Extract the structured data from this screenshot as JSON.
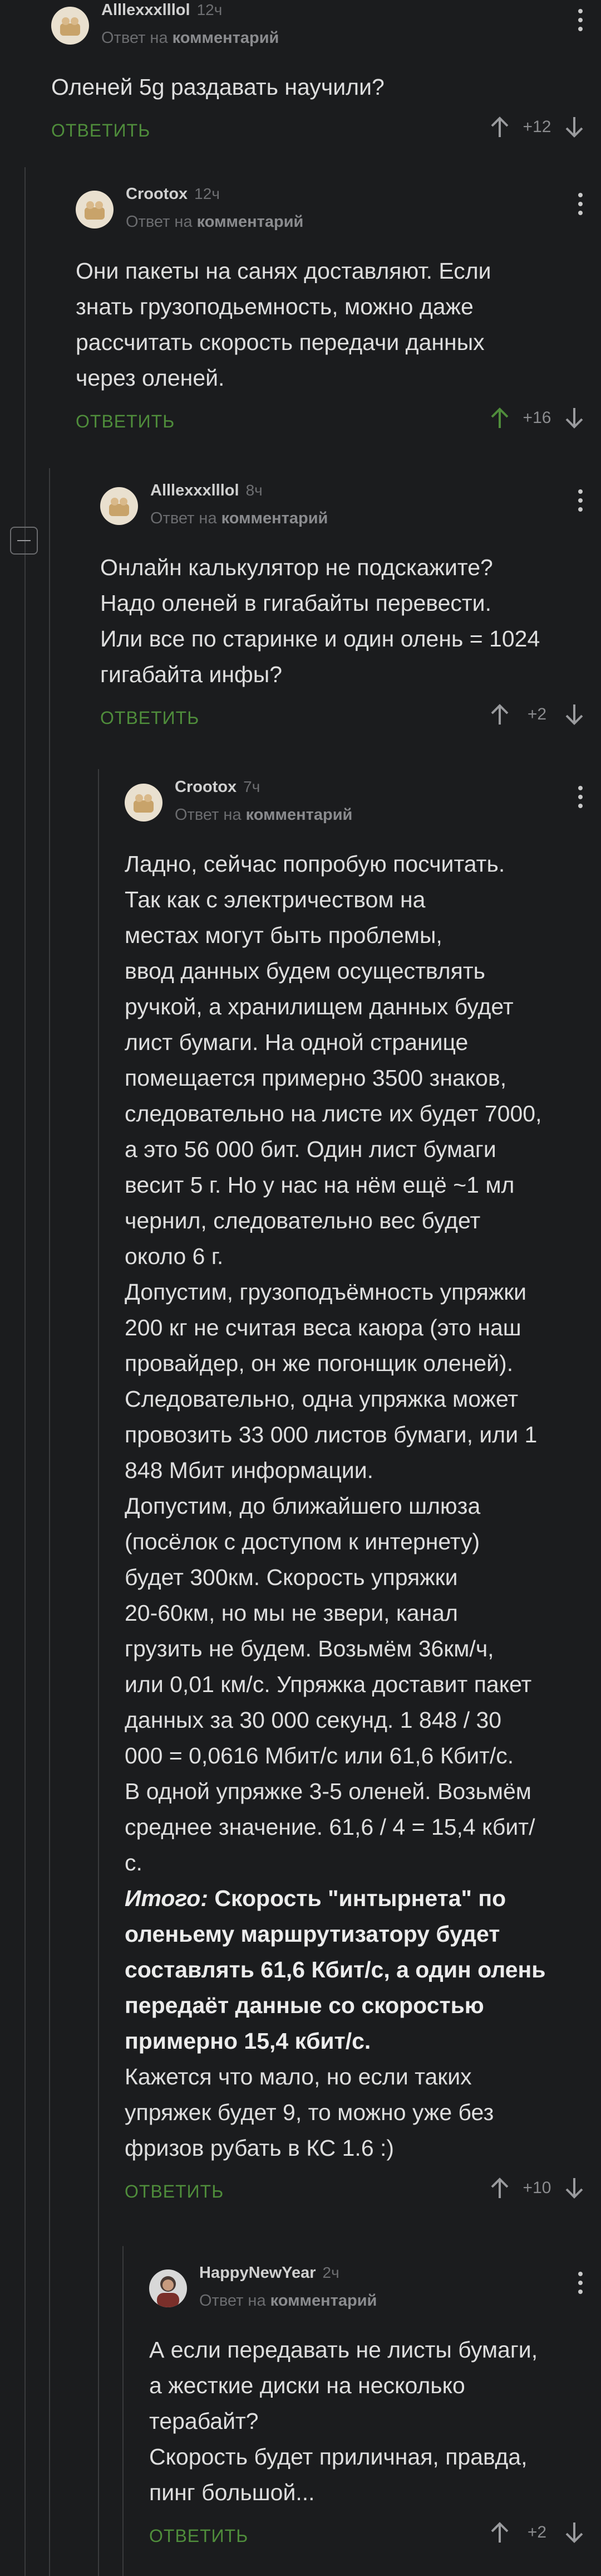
{
  "colors": {
    "background": "#1b1c1e",
    "accent_green": "#4f8d3b",
    "upvote_active": "#4f8d3b"
  },
  "comments": [
    {
      "author": "Alllexxxlllol",
      "time": "12ч",
      "reply_prefix": "Ответ на",
      "reply_target": "комментарий",
      "body": "Оленей 5g раздавать научили?",
      "reply_label": "ОТВЕТИТЬ",
      "score": "+12"
    },
    {
      "author": "Crootox",
      "time": "12ч",
      "reply_prefix": "Ответ на",
      "reply_target": "комментарий",
      "body": "Они пакеты на санях доставляют. Если\nзнать грузоподьемность, можно даже\nрассчитать скорость передачи данных\nчерез оленей.",
      "reply_label": "ОТВЕТИТЬ",
      "score": "+16",
      "upvoted": true
    },
    {
      "author": "Alllexxxlllol",
      "time": "8ч",
      "reply_prefix": "Ответ на",
      "reply_target": "комментарий",
      "body": "Онлайн калькулятор не подскажите?\nНадо оленей в гигабайты перевести.\nИли все по старинке и один олень = 1024\nгигабайта инфы?",
      "reply_label": "ОТВЕТИТЬ",
      "score": "+2"
    },
    {
      "author": "Crootox",
      "time": "7ч",
      "reply_prefix": "Ответ на",
      "reply_target": "комментарий",
      "body": "Ладно, сейчас попробую посчитать.\nТак как с электричеством на\nместах могут быть проблемы,\nввод данных будем осуществлять\nручкой, а хранилищем данных будет\nлист бумаги. На одной странице\nпомещается примерно 3500 знаков,\nследовательно на листе их будет 7000,\nа это 56 000 бит. Один лист бумаги\nвесит 5 г. Но у нас на нём ещё ~1 мл\nчернил, следовательно вес будет\nоколо 6 г.\nДопустим, грузоподъёмность упряжки\n200 кг не считая веса каюра (это наш\nпровайдер, он же погонщик оленей).\nСледовательно, одна упряжка может\nпровозить 33 000 листов бумаги, или 1\n848 Мбит информации.\nДопустим, до ближайшего шлюза\n(посёлок с доступом к интернету)\nбудет 300км. Скорость упряжки\n20-60км, но мы не звери, канал\nгрузить не будем. Возьмём 36км/ч,\nили 0,01 км/с. Упряжка доставит пакет\nданных за 30 000 секунд. 1 848 / 30\n000 = 0,0616 Мбит/с или 61,6 Кбит/с.\nВ одной упряжке 3-5 оленей. Возьмём\nсреднее значение. 61,6 / 4 = 15,4 кбит/\nс.",
      "body_bold_label": "Итого:",
      "body_bold": " Скорость \"интырнета\" по\nоленьему маршрутизатору будет\nсоставлять 61,6 Кбит/с, а один олень\nпередаёт данные со скоростью\nпримерно 15,4 кбит/с.",
      "body_tail": "Кажется что мало, но если таких\nупряжек будет 9, то можно уже без\nфризов рубать в КС 1.6 :)",
      "reply_label": "ОТВЕТИТЬ",
      "score": "+10"
    },
    {
      "author": "HappyNewYear",
      "time": "2ч",
      "reply_prefix": "Ответ на",
      "reply_target": "комментарий",
      "body": "А если передавать не листы бумаги,\nа жесткие диски на несколько\nтерабайт?\nСкорость будет приличная, правда,\nпинг большой...",
      "reply_label": "ОТВЕТИТЬ",
      "score": "+2"
    }
  ]
}
